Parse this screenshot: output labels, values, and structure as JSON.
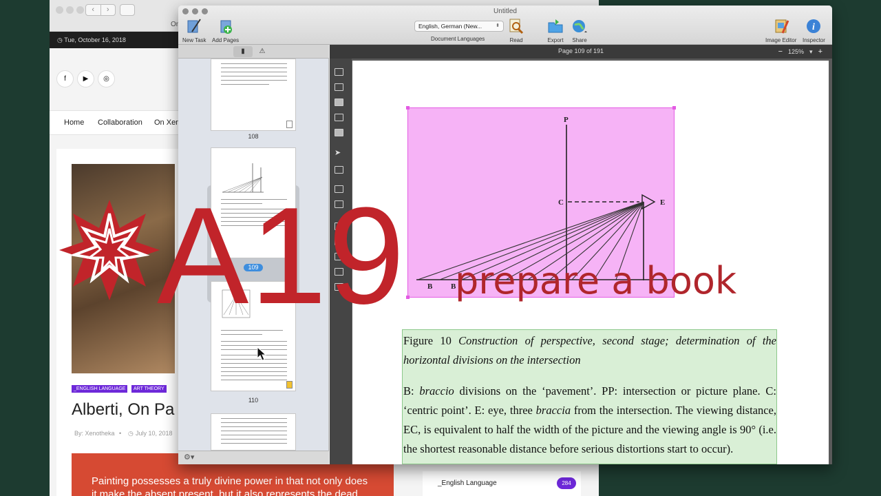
{
  "browser": {
    "url_fragment": "On",
    "date": "Tue, October 16, 2018",
    "social": [
      "f",
      "▶",
      "◎"
    ],
    "nav": [
      "Home",
      "Collaboration",
      "On Xeno"
    ],
    "tags": [
      "_ENGLISH LANGUAGE",
      "ART THEORY"
    ],
    "article_title": "Alberti, On Pa",
    "author": "By: Xenotheka",
    "date_posted": "July 10, 2018",
    "quote_lines": [
      "Painting possesses a truly divine power in that not only does",
      "it make the absent present, but it also represents the dead"
    ],
    "sidebar_label": "_English Language",
    "sidebar_count": "284"
  },
  "app": {
    "title": "Untitled",
    "toolbar": {
      "new_task": "New Task",
      "add_pages": "Add Pages",
      "language": "English, German (New...",
      "doc_languages": "Document Languages",
      "read": "Read",
      "export": "Export",
      "share": "Share",
      "image_editor": "Image Editor",
      "inspector": "Inspector"
    },
    "page_info": "Page 109 of 191",
    "zoom": "125%",
    "thumbnails": [
      "108",
      "109",
      "110"
    ],
    "selected_page": "109",
    "figure": {
      "labels": [
        "P",
        "C",
        "E",
        "B",
        "B"
      ]
    },
    "recognized_text": {
      "caption_prefix": "Figure 10 ",
      "caption_italic": "Construction of perspective, second stage; determination of the horizontal divisions on the intersection",
      "body_1": "B: ",
      "body_2": "braccio",
      "body_3": " divisions on the ‘pavement’. PP: intersection or picture plane. C: ‘centric point’. E: eye, three ",
      "body_4": "braccia",
      "body_5": " from the intersection. The viewing distance, EC, is equivalent to half the width of the picture and the viewing angle is 90° (i.e. the shortest reasonable distance before serious distortions start to occur)."
    }
  },
  "overlay": {
    "brand": "A19",
    "tagline": "prepare a book"
  },
  "colors": {
    "brand_red": "#c1242a",
    "picture_region": "#f185f1",
    "text_region": "#cfebcc",
    "accent_purple": "#6d28d9"
  }
}
